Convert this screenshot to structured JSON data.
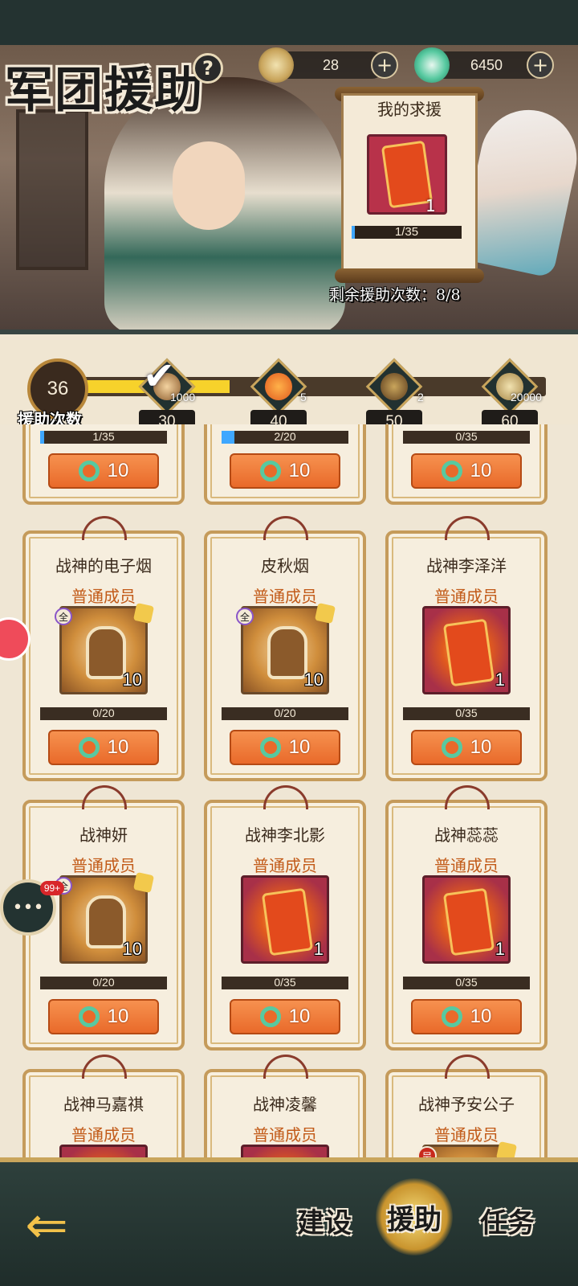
{
  "header": {
    "title": "军团援助",
    "help_icon": "?"
  },
  "currencies": [
    {
      "name": "coin",
      "icon": "coin-icon",
      "value": "28"
    },
    {
      "name": "jade",
      "icon": "jade-icon",
      "value": "6450"
    }
  ],
  "my_request": {
    "title": "我的求援",
    "item_icon": "red-pouch-icon",
    "item_qty": "1",
    "progress_text": "1/35",
    "progress": 0.029
  },
  "remaining": "剩余援助次数：8/8",
  "progress_track": {
    "count": "36",
    "count_label": "援助次数",
    "fill_ratio": 0.32,
    "milestones": [
      {
        "label": "30",
        "reward_qty": "1000",
        "icon": "helmet-icon",
        "claimed": true
      },
      {
        "label": "40",
        "reward_qty": "5",
        "icon": "red-pouch-icon",
        "claimed": false
      },
      {
        "label": "50",
        "reward_qty": "2",
        "icon": "bow-icon",
        "claimed": false
      },
      {
        "label": "60",
        "reward_qty": "20000",
        "icon": "coin-icon",
        "claimed": false
      }
    ]
  },
  "partial_cards": [
    {
      "progress_text": "1/35",
      "progress": 0.029,
      "button": "10"
    },
    {
      "progress_text": "2/20",
      "progress": 0.1,
      "button": "10"
    },
    {
      "progress_text": "0/35",
      "progress": 0,
      "button": "10"
    }
  ],
  "cards": [
    {
      "name": "战神的电子烟",
      "rank": "普通成员",
      "item": "armor",
      "badge": "全",
      "qty": "10",
      "progress_text": "0/20",
      "progress": 0,
      "button": "10"
    },
    {
      "name": "皮秋烟",
      "rank": "普通成员",
      "item": "armor",
      "badge": "全",
      "qty": "10",
      "progress_text": "0/20",
      "progress": 0,
      "button": "10"
    },
    {
      "name": "战神李泽洋",
      "rank": "普通成员",
      "item": "pouch",
      "badge": "",
      "qty": "1",
      "progress_text": "0/35",
      "progress": 0,
      "button": "10"
    },
    {
      "name": "战神妍",
      "rank": "普通成员",
      "item": "armor",
      "badge": "全",
      "qty": "10",
      "progress_text": "0/20",
      "progress": 0,
      "button": "10"
    },
    {
      "name": "战神李北影",
      "rank": "普通成员",
      "item": "pouch",
      "badge": "",
      "qty": "1",
      "progress_text": "0/35",
      "progress": 0,
      "button": "10"
    },
    {
      "name": "战神蕊蕊",
      "rank": "普通成员",
      "item": "pouch",
      "badge": "",
      "qty": "1",
      "progress_text": "0/35",
      "progress": 0,
      "button": "10"
    },
    {
      "name": "战神马嘉祺",
      "rank": "普通成员",
      "item": "pouch",
      "badge": "",
      "qty": "",
      "progress_text": "",
      "progress": 0,
      "button": ""
    },
    {
      "name": "战神凌馨",
      "rank": "普通成员",
      "item": "pouch",
      "badge": "",
      "qty": "",
      "progress_text": "",
      "progress": 0,
      "button": ""
    },
    {
      "name": "战神予安公子",
      "rank": "普通成员",
      "item": "armor",
      "badge": "吴",
      "qty": "",
      "progress_text": "",
      "progress": 0,
      "button": ""
    }
  ],
  "chat": {
    "badge": "99+",
    "icon": "chat-bubble-icon"
  },
  "bottom_nav": {
    "back_icon": "back-arrow-icon",
    "tabs": [
      {
        "label": "建设",
        "active": false
      },
      {
        "label": "援助",
        "active": true
      },
      {
        "label": "任务",
        "active": false
      }
    ]
  },
  "colors": {
    "accent_orange": "#e96a2a",
    "progress_blue": "#3ea7ff",
    "track_yellow": "#f7d22b",
    "rank_orange": "#c25a18"
  }
}
